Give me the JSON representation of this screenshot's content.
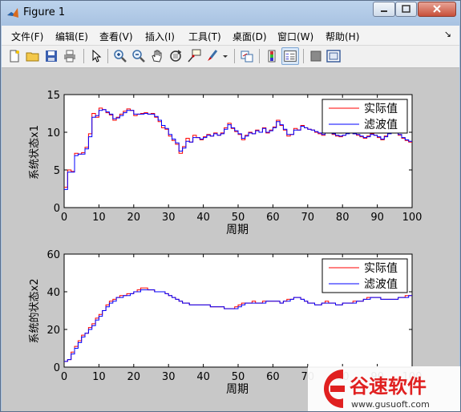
{
  "window": {
    "title": "Figure 1"
  },
  "menu": [
    "文件(F)",
    "编辑(E)",
    "查看(V)",
    "插入(I)",
    "工具(T)",
    "桌面(D)",
    "窗口(W)",
    "帮助(H)"
  ],
  "toolbar_icons": [
    "new-file-icon",
    "open-folder-icon",
    "save-icon",
    "print-icon",
    "pointer-icon",
    "zoom-in-icon",
    "zoom-out-icon",
    "pan-hand-icon",
    "rotate-3d-icon",
    "data-cursor-icon",
    "brush-icon",
    "brush-dropdown-icon",
    "link-plot-icon",
    "colorbar-icon",
    "legend-icon",
    "hide-plot-tools-icon",
    "show-plot-tools-icon"
  ],
  "watermark": {
    "brand": "谷速软件",
    "url": "www.gusuoft.com"
  },
  "colors": {
    "actual": "#ff0000",
    "filtered": "#0000ff"
  },
  "chart_data": [
    {
      "type": "line",
      "title": "",
      "xlabel": "周期",
      "ylabel": "系统状态x1",
      "xlim": [
        0,
        100
      ],
      "ylim": [
        0,
        15
      ],
      "xticks": [
        0,
        10,
        20,
        30,
        40,
        50,
        60,
        70,
        80,
        90,
        100
      ],
      "yticks": [
        0,
        5,
        10,
        15
      ],
      "legend": {
        "position": "top-right",
        "entries": [
          "实际值",
          "滤波值"
        ]
      },
      "step": true,
      "x": [
        1,
        2,
        3,
        4,
        5,
        6,
        7,
        8,
        9,
        10,
        11,
        12,
        13,
        14,
        15,
        16,
        17,
        18,
        19,
        20,
        21,
        22,
        23,
        24,
        25,
        26,
        27,
        28,
        29,
        30,
        31,
        32,
        33,
        34,
        35,
        36,
        37,
        38,
        39,
        40,
        41,
        42,
        43,
        44,
        45,
        46,
        47,
        48,
        49,
        50,
        51,
        52,
        53,
        54,
        55,
        56,
        57,
        58,
        59,
        60,
        61,
        62,
        63,
        64,
        65,
        66,
        67,
        68,
        69,
        70,
        71,
        72,
        73,
        74,
        75,
        76,
        77,
        78,
        79,
        80,
        81,
        82,
        83,
        84,
        85,
        86,
        87,
        88,
        89,
        90,
        91,
        92,
        93,
        94,
        95,
        96,
        97,
        98,
        99,
        100
      ],
      "series": [
        {
          "name": "实际值",
          "color": "#ff0000",
          "values": [
            2.7,
            5.0,
            4.8,
            7.2,
            7.1,
            7.3,
            8.0,
            9.8,
            12.5,
            12.0,
            13.2,
            13.0,
            12.6,
            12.3,
            11.6,
            12.0,
            12.4,
            12.8,
            13.1,
            12.9,
            12.2,
            12.4,
            12.5,
            12.6,
            12.4,
            12.5,
            12.0,
            11.4,
            10.6,
            10.4,
            9.5,
            8.9,
            8.4,
            7.2,
            8.1,
            9.2,
            8.7,
            9.6,
            9.3,
            9.0,
            9.4,
            9.7,
            9.5,
            9.9,
            9.6,
            9.9,
            10.6,
            11.2,
            10.5,
            10.1,
            9.7,
            9.0,
            9.6,
            10.0,
            9.8,
            10.3,
            10.0,
            10.6,
            9.9,
            10.3,
            10.7,
            11.6,
            10.9,
            10.3,
            9.5,
            9.7,
            10.5,
            10.3,
            10.9,
            10.6,
            10.4,
            10.3,
            10.0,
            9.8,
            9.6,
            10.5,
            10.1,
            9.7,
            9.5,
            9.4,
            9.6,
            9.9,
            10.1,
            9.8,
            9.6,
            9.4,
            9.2,
            9.5,
            9.8,
            9.6,
            9.3,
            9.0,
            9.5,
            9.9,
            10.3,
            10.0,
            9.6,
            9.2,
            8.9,
            8.7
          ]
        },
        {
          "name": "滤波值",
          "color": "#0000ff",
          "values": [
            2.4,
            4.7,
            4.7,
            6.9,
            7.1,
            7.1,
            7.8,
            9.4,
            12.0,
            12.2,
            12.9,
            13.0,
            12.7,
            12.4,
            11.8,
            11.9,
            12.2,
            12.6,
            12.9,
            12.9,
            12.4,
            12.4,
            12.4,
            12.5,
            12.4,
            12.4,
            12.1,
            11.6,
            10.9,
            10.5,
            9.7,
            9.1,
            8.6,
            7.5,
            7.9,
            8.8,
            8.7,
            9.3,
            9.3,
            9.1,
            9.3,
            9.6,
            9.5,
            9.8,
            9.6,
            9.8,
            10.4,
            11.0,
            10.6,
            10.2,
            9.8,
            9.2,
            9.5,
            9.9,
            9.8,
            10.2,
            10.0,
            10.5,
            10.0,
            10.2,
            10.6,
            11.4,
            11.0,
            10.4,
            9.7,
            9.7,
            10.3,
            10.3,
            10.8,
            10.6,
            10.4,
            10.3,
            10.1,
            9.9,
            9.7,
            10.3,
            10.1,
            9.8,
            9.6,
            9.5,
            9.6,
            9.8,
            10.0,
            9.8,
            9.7,
            9.5,
            9.3,
            9.4,
            9.7,
            9.6,
            9.4,
            9.1,
            9.4,
            9.8,
            10.2,
            10.0,
            9.7,
            9.3,
            9.0,
            8.8
          ]
        }
      ]
    },
    {
      "type": "line",
      "title": "",
      "xlabel": "周期",
      "ylabel": "系统的状态x2",
      "xlim": [
        0,
        100
      ],
      "ylim": [
        0,
        60
      ],
      "xticks": [
        0,
        10,
        20,
        30,
        40,
        50,
        60,
        70,
        80,
        90,
        100
      ],
      "yticks": [
        0,
        20,
        40,
        60
      ],
      "legend": {
        "position": "top-right",
        "entries": [
          "实际值",
          "滤波值"
        ]
      },
      "step": true,
      "x": [
        1,
        2,
        3,
        4,
        5,
        6,
        7,
        8,
        9,
        10,
        11,
        12,
        13,
        14,
        15,
        16,
        17,
        18,
        19,
        20,
        21,
        22,
        23,
        24,
        25,
        26,
        27,
        28,
        29,
        30,
        31,
        32,
        33,
        34,
        35,
        36,
        37,
        38,
        39,
        40,
        41,
        42,
        43,
        44,
        45,
        46,
        47,
        48,
        49,
        50,
        51,
        52,
        53,
        54,
        55,
        56,
        57,
        58,
        59,
        60,
        61,
        62,
        63,
        64,
        65,
        66,
        67,
        68,
        69,
        70,
        71,
        72,
        73,
        74,
        75,
        76,
        77,
        78,
        79,
        80,
        81,
        82,
        83,
        84,
        85,
        86,
        87,
        88,
        89,
        90,
        91,
        92,
        93,
        94,
        95,
        96,
        97,
        98,
        99,
        100
      ],
      "series": [
        {
          "name": "实际值",
          "color": "#ff0000",
          "values": [
            3,
            4,
            8,
            11,
            14,
            17,
            18,
            21,
            23,
            26,
            28,
            30,
            33,
            35,
            36,
            37,
            38,
            38,
            39,
            39,
            40,
            41,
            42,
            42,
            41,
            41,
            40,
            40,
            40,
            39,
            38,
            37,
            36,
            35,
            34,
            34,
            33,
            33,
            33,
            33,
            33,
            33,
            32,
            32,
            32,
            32,
            31,
            31,
            31,
            32,
            33,
            34,
            34,
            34,
            35,
            34,
            34,
            35,
            35,
            35,
            35,
            35,
            34,
            35,
            36,
            36,
            37,
            37,
            36,
            35,
            34,
            34,
            33,
            33,
            34,
            35,
            34,
            34,
            33,
            33,
            34,
            34,
            34,
            35,
            35,
            35,
            36,
            37,
            37,
            37,
            37,
            36,
            36,
            36,
            36,
            36,
            37,
            37,
            38,
            38
          ]
        },
        {
          "name": "滤波值",
          "color": "#0000ff",
          "values": [
            3,
            4,
            7,
            10,
            13,
            16,
            18,
            20,
            22,
            25,
            27,
            30,
            32,
            34,
            35,
            37,
            37,
            38,
            38,
            39,
            40,
            40,
            41,
            41,
            41,
            41,
            40,
            40,
            40,
            39,
            38,
            37,
            36,
            35,
            34,
            34,
            33,
            33,
            33,
            33,
            33,
            33,
            32,
            32,
            32,
            32,
            31,
            31,
            31,
            31,
            32,
            33,
            34,
            34,
            34,
            34,
            34,
            34,
            35,
            35,
            35,
            35,
            34,
            35,
            35,
            36,
            37,
            37,
            36,
            35,
            34,
            34,
            33,
            33,
            34,
            34,
            34,
            34,
            33,
            33,
            34,
            34,
            34,
            34,
            35,
            35,
            36,
            36,
            37,
            37,
            37,
            36,
            36,
            36,
            36,
            36,
            37,
            37,
            37,
            38
          ]
        }
      ]
    }
  ]
}
